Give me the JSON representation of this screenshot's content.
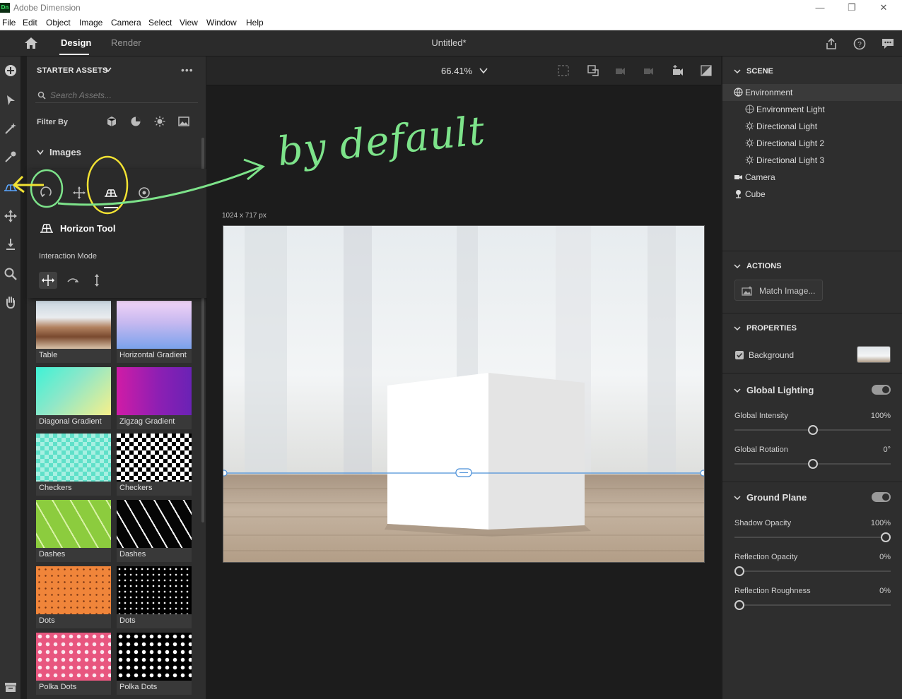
{
  "window": {
    "title": "Adobe Dimension",
    "logo": "Dn"
  },
  "menu": [
    "File",
    "Edit",
    "Object",
    "Image",
    "Camera",
    "Select",
    "View",
    "Window",
    "Help"
  ],
  "header": {
    "tabs": [
      "Design",
      "Render"
    ],
    "doc_title": "Untitled*"
  },
  "assets": {
    "title": "STARTER ASSETS",
    "search_placeholder": "Search Assets...",
    "filter_label": "Filter By",
    "section": "Images",
    "thumbs": [
      "Table",
      "Horizontal Gradient",
      "Diagonal Gradient",
      "Zigzag Gradient",
      "Checkers",
      "Checkers",
      "Dashes",
      "Dashes",
      "Dots",
      "Dots",
      "Polka Dots",
      "Polka Dots"
    ]
  },
  "popup": {
    "title": "Horizon Tool",
    "sub": "Interaction Mode"
  },
  "canvas": {
    "zoom": "66.41%",
    "size_label": "1024 x 717 px"
  },
  "scene": {
    "title": "SCENE",
    "items": [
      "Environment",
      "Environment Light",
      "Directional Light",
      "Directional Light 2",
      "Directional Light 3",
      "Camera",
      "Cube"
    ]
  },
  "actions": {
    "title": "ACTIONS",
    "match_image": "Match Image..."
  },
  "properties": {
    "title": "PROPERTIES",
    "background": "Background",
    "global_lighting": "Global Lighting",
    "global_intensity": {
      "label": "Global Intensity",
      "value": "100%"
    },
    "global_rotation": {
      "label": "Global Rotation",
      "value": "0°"
    },
    "ground_plane": "Ground Plane",
    "shadow_opacity": {
      "label": "Shadow Opacity",
      "value": "100%"
    },
    "reflection_opacity": {
      "label": "Reflection Opacity",
      "value": "0%"
    },
    "reflection_roughness": {
      "label": "Reflection Roughness",
      "value": "0%"
    }
  },
  "annotation": {
    "text": "by default"
  }
}
